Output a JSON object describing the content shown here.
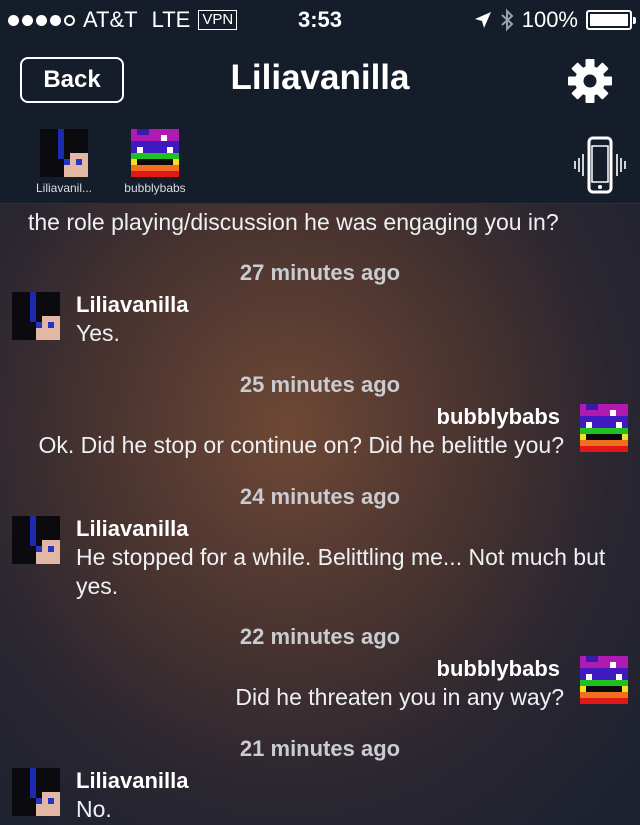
{
  "status_bar": {
    "carrier": "AT&T",
    "network": "LTE",
    "vpn": "VPN",
    "time": "3:53",
    "battery": "100%",
    "battery_level": 1.0,
    "signal_bars_filled": 4,
    "signal_bars_total": 5
  },
  "nav": {
    "back_label": "Back",
    "title": "Liliavanilla",
    "settings_icon": "gear-icon"
  },
  "participants": [
    {
      "name": "Liliavanil...",
      "avatar": "liliavanilla-avatar"
    },
    {
      "name": "bubblybabs",
      "avatar": "bubblybabs-avatar"
    }
  ],
  "participants_action_icon": "phone-vibrate-icon",
  "chat": {
    "cut_off_text": "the role playing/discussion he was engaging you in?",
    "entries": [
      {
        "timestamp": "27 minutes ago",
        "sender": "Liliavanilla",
        "direction": "in",
        "text": "Yes."
      },
      {
        "timestamp": "25 minutes ago",
        "sender": "bubblybabs",
        "direction": "out",
        "text": "Ok.  Did he stop or continue on?  Did he belittle you?"
      },
      {
        "timestamp": "24 minutes ago",
        "sender": "Liliavanilla",
        "direction": "in",
        "text": "He stopped for a while. Belittling me... Not much but yes."
      },
      {
        "timestamp": "22 minutes ago",
        "sender": "bubblybabs",
        "direction": "out",
        "text": "Did he threaten you in any way?"
      },
      {
        "timestamp": "21 minutes ago",
        "sender": "Liliavanilla",
        "direction": "in",
        "text": "No."
      }
    ]
  },
  "colors": {
    "bar_background": "#151c2a",
    "text_primary": "#ffffff",
    "timestamp": "#c9ccd1"
  }
}
